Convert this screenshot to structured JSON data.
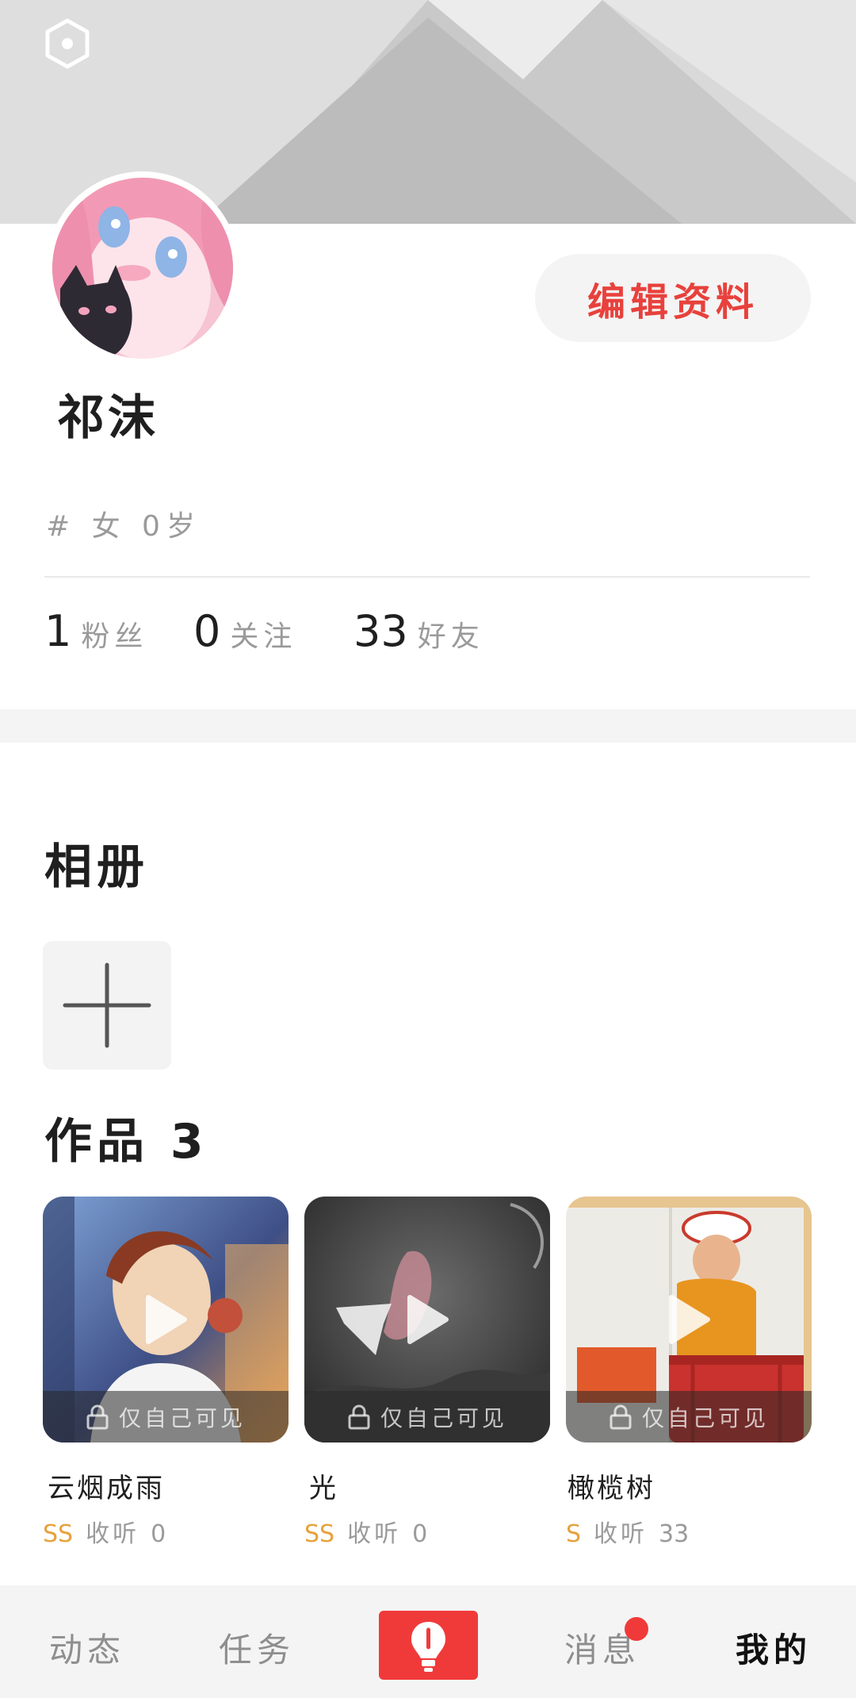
{
  "profile": {
    "edit_label": "编辑资料",
    "username": "祁沫",
    "tags": "# 女 0岁",
    "stats": {
      "fans": {
        "value": "1",
        "label": "粉丝"
      },
      "following": {
        "value": "0",
        "label": "关注"
      },
      "friends": {
        "value": "33",
        "label": "好友"
      }
    }
  },
  "album": {
    "title": "相册"
  },
  "works": {
    "title": "作品 3",
    "private_label": "仅自己可见",
    "listen_label": "收听",
    "items": [
      {
        "title": "云烟成雨",
        "grade": "SS",
        "listens": "0"
      },
      {
        "title": "光",
        "grade": "SS",
        "listens": "0"
      },
      {
        "title": "橄榄树",
        "grade": "S",
        "listens": "33"
      }
    ]
  },
  "tabbar": {
    "items": [
      "动态",
      "任务",
      "消息",
      "我的"
    ],
    "active": "我的"
  },
  "colors": {
    "accent": "#f03a3a",
    "edit_text": "#e8413c",
    "grade": "#e6a23c"
  },
  "icons": [
    "settings-hexagon-icon",
    "plus-icon",
    "play-icon",
    "lock-icon",
    "bulb-icon"
  ]
}
